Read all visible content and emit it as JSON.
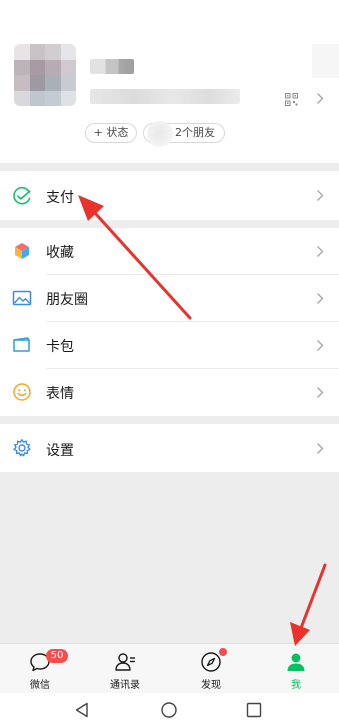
{
  "profile": {
    "status_label": "+ 状态",
    "friends_label": "2个朋友"
  },
  "menu": {
    "pay": {
      "label": "支付",
      "icon": "pay-check-icon"
    },
    "favorites": {
      "label": "收藏",
      "icon": "cube-icon"
    },
    "moments": {
      "label": "朋友圈",
      "icon": "picture-icon"
    },
    "cards": {
      "label": "卡包",
      "icon": "card-icon"
    },
    "stickers": {
      "label": "表情",
      "icon": "smiley-icon"
    },
    "settings": {
      "label": "设置",
      "icon": "gear-icon"
    }
  },
  "tabs": [
    {
      "label": "微信",
      "icon": "chat-bubble-icon",
      "badge": "50"
    },
    {
      "label": "通讯录",
      "icon": "contacts-icon"
    },
    {
      "label": "发现",
      "icon": "compass-icon"
    },
    {
      "label": "我",
      "icon": "person-icon",
      "active": true
    }
  ],
  "colors": {
    "brand_green": "#07c160",
    "badge_red": "#f44d4d",
    "annotation_red": "#e8322b"
  }
}
